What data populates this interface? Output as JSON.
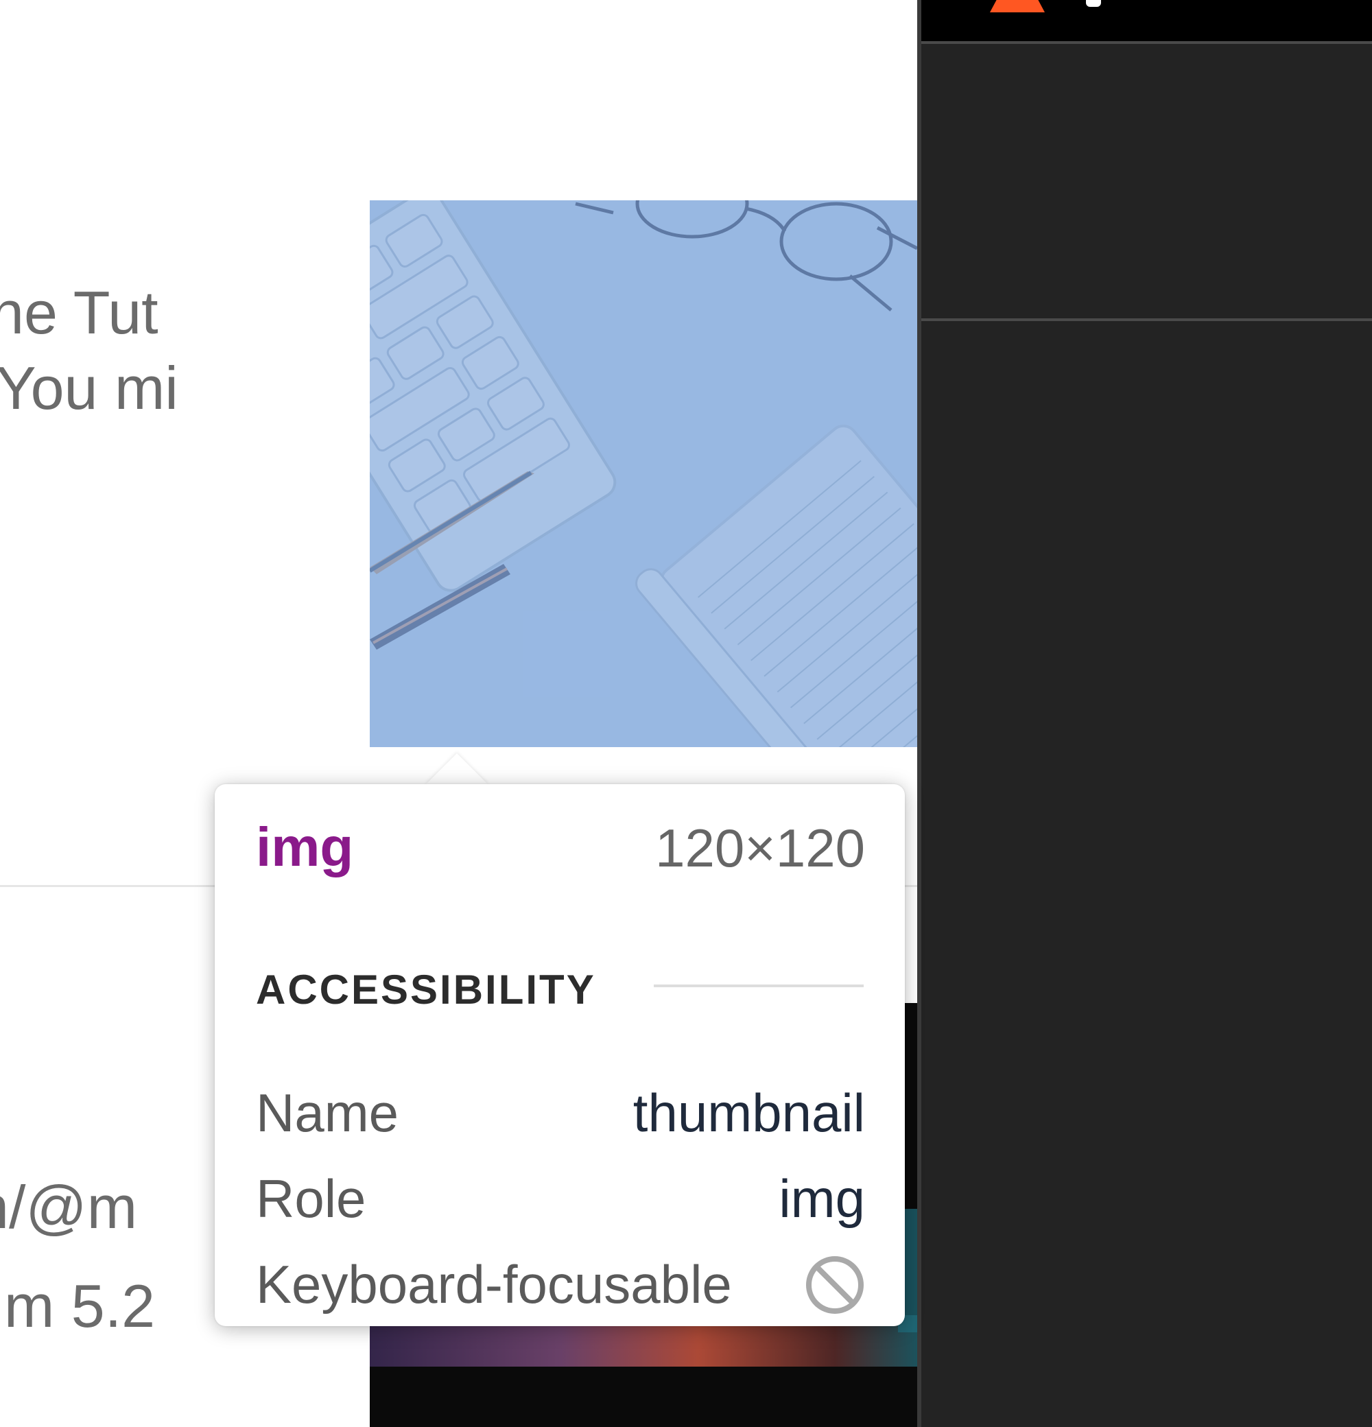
{
  "page": {
    "snippets": [
      {
        "text": "ne Tut"
      },
      {
        "text": "You mi"
      },
      {
        "text": "n/@m"
      },
      {
        "text": "m 5.2"
      }
    ]
  },
  "tooltip": {
    "tag": "img",
    "size": "120×120",
    "section_title": "ACCESSIBILITY",
    "rows": [
      {
        "key": "Name",
        "value": "thumbnail"
      },
      {
        "key": "Role",
        "value": "img"
      },
      {
        "key": "Keyboard-focusable",
        "value": "",
        "icon": "not-allowed-icon"
      }
    ]
  },
  "colors": {
    "tag": "#8a1a8a",
    "highlight_overlay": "#6f9ad6",
    "side_panel": "#232323",
    "brand_accent": "#ff5722"
  }
}
